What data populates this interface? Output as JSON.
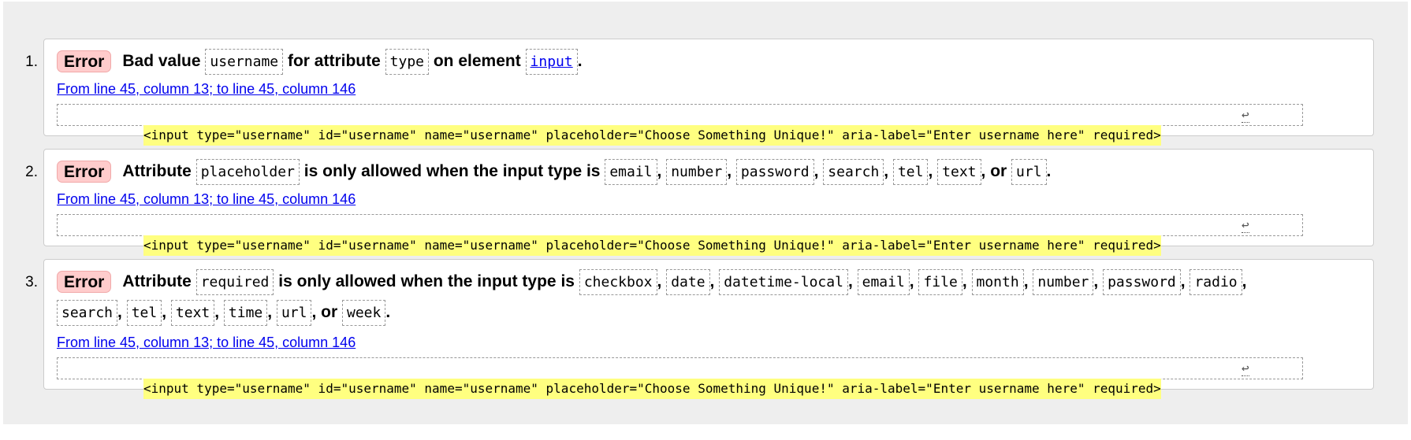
{
  "messages": [
    {
      "number": "1.",
      "badge": "Error",
      "text": {
        "p1": "Bad value",
        "c1": "username",
        "p2": "for attribute",
        "c2": "type",
        "p3": "on element",
        "c3": "input",
        "p4": "."
      },
      "location": "From line 45, column 13; to line 45, column 146",
      "extract": "<input type=\"username\" id=\"username\" name=\"username\" placeholder=\"Choose Something Unique!\" aria-label=\"Enter username here\" required>",
      "return_glyph": "↩"
    },
    {
      "number": "2.",
      "badge": "Error",
      "text": {
        "p1": "Attribute",
        "c1": "placeholder",
        "p2": "is only allowed when the input type is",
        "types": [
          "email",
          "number",
          "password",
          "search",
          "tel",
          "text",
          "url"
        ],
        "or": "or",
        "end": "."
      },
      "location": "From line 45, column 13; to line 45, column 146",
      "extract": "<input type=\"username\" id=\"username\" name=\"username\" placeholder=\"Choose Something Unique!\" aria-label=\"Enter username here\" required>",
      "return_glyph": "↩"
    },
    {
      "number": "3.",
      "badge": "Error",
      "text": {
        "p1": "Attribute",
        "c1": "required",
        "p2": "is only allowed when the input type is",
        "types_line1": [
          "checkbox",
          "date",
          "datetime-local",
          "email",
          "file",
          "month",
          "number",
          "password",
          "radio"
        ],
        "types_line2": [
          "search",
          "tel",
          "text",
          "time",
          "url"
        ],
        "last": "week",
        "or": "or",
        "end": "."
      },
      "location": "From line 45, column 13; to line 45, column 146",
      "extract": "<input type=\"username\" id=\"username\" name=\"username\" placeholder=\"Choose Something Unique!\" aria-label=\"Enter username here\" required>",
      "return_glyph": "↩"
    }
  ]
}
